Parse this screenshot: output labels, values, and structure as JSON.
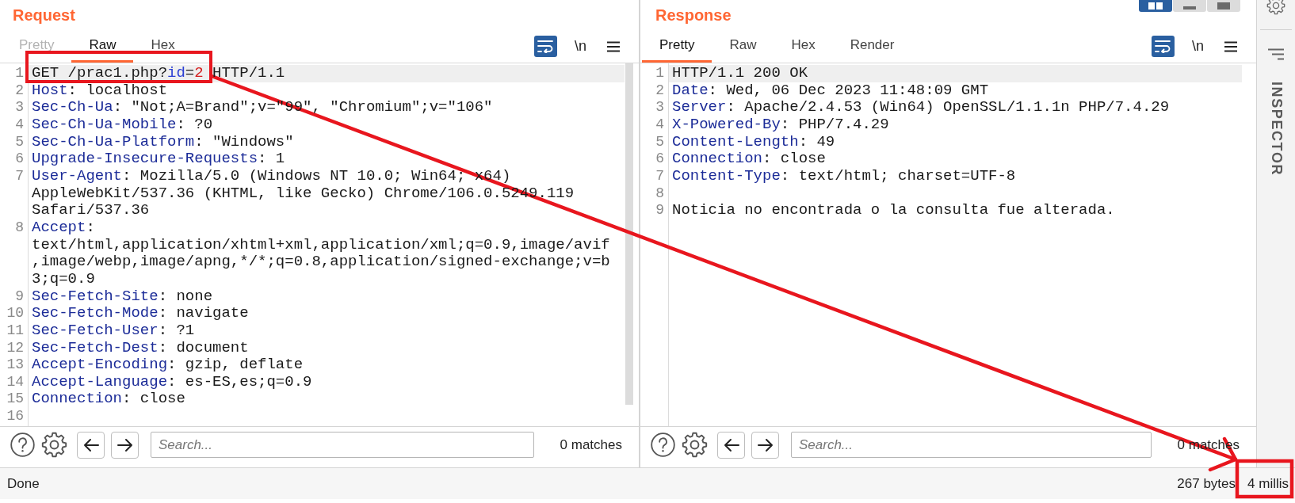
{
  "request": {
    "title": "Request",
    "tabs": [
      {
        "label": "Pretty",
        "selected": false,
        "disabled": true
      },
      {
        "label": "Raw",
        "selected": true,
        "disabled": false
      },
      {
        "label": "Hex",
        "selected": false,
        "disabled": false
      }
    ],
    "controls": {
      "word_wrap": true,
      "newline_label": "\\n"
    },
    "lines": [
      {
        "number": "1",
        "highlighted": true,
        "tokens": [
          {
            "kind": "text",
            "text": "GET /prac1.php?"
          },
          {
            "kind": "param_name",
            "text": "id"
          },
          {
            "kind": "text",
            "text": "="
          },
          {
            "kind": "param_value",
            "text": "2"
          },
          {
            "kind": "text",
            "text": " HTTP/1.1"
          }
        ]
      },
      {
        "number": "2",
        "highlighted": false,
        "tokens": [
          {
            "kind": "header_name",
            "text": "Host"
          },
          {
            "kind": "text",
            "text": ": localhost"
          }
        ]
      },
      {
        "number": "3",
        "highlighted": false,
        "tokens": [
          {
            "kind": "header_name",
            "text": "Sec-Ch-Ua"
          },
          {
            "kind": "text",
            "text": ": \"Not;A=Brand\";v=\"99\", \"Chromium\";v=\"106\""
          }
        ]
      },
      {
        "number": "4",
        "highlighted": false,
        "tokens": [
          {
            "kind": "header_name",
            "text": "Sec-Ch-Ua-Mobile"
          },
          {
            "kind": "text",
            "text": ": ?0"
          }
        ]
      },
      {
        "number": "5",
        "highlighted": false,
        "tokens": [
          {
            "kind": "header_name",
            "text": "Sec-Ch-Ua-Platform"
          },
          {
            "kind": "text",
            "text": ": \"Windows\""
          }
        ]
      },
      {
        "number": "6",
        "highlighted": false,
        "tokens": [
          {
            "kind": "header_name",
            "text": "Upgrade-Insecure-Requests"
          },
          {
            "kind": "text",
            "text": ": 1"
          }
        ]
      },
      {
        "number": "7",
        "highlighted": false,
        "tokens": [
          {
            "kind": "header_name",
            "text": "User-Agent"
          },
          {
            "kind": "text",
            "text": ": Mozilla/5.0 (Windows NT 10.0; Win64; x64)"
          }
        ],
        "continued": [
          "AppleWebKit/537.36 (KHTML, like Gecko) Chrome/106.0.5249.119",
          "Safari/537.36"
        ]
      },
      {
        "number": "8",
        "highlighted": false,
        "tokens": [
          {
            "kind": "header_name",
            "text": "Accept"
          },
          {
            "kind": "text",
            "text": ":"
          }
        ],
        "continued": [
          "text/html,application/xhtml+xml,application/xml;q=0.9,image/avif",
          ",image/webp,image/apng,*/*;q=0.8,application/signed-exchange;v=b",
          "3;q=0.9"
        ]
      },
      {
        "number": "9",
        "highlighted": false,
        "tokens": [
          {
            "kind": "header_name",
            "text": "Sec-Fetch-Site"
          },
          {
            "kind": "text",
            "text": ": none"
          }
        ]
      },
      {
        "number": "10",
        "highlighted": false,
        "tokens": [
          {
            "kind": "header_name",
            "text": "Sec-Fetch-Mode"
          },
          {
            "kind": "text",
            "text": ": navigate"
          }
        ]
      },
      {
        "number": "11",
        "highlighted": false,
        "tokens": [
          {
            "kind": "header_name",
            "text": "Sec-Fetch-User"
          },
          {
            "kind": "text",
            "text": ": ?1"
          }
        ]
      },
      {
        "number": "12",
        "highlighted": false,
        "tokens": [
          {
            "kind": "header_name",
            "text": "Sec-Fetch-Dest"
          },
          {
            "kind": "text",
            "text": ": document"
          }
        ]
      },
      {
        "number": "13",
        "highlighted": false,
        "tokens": [
          {
            "kind": "header_name",
            "text": "Accept-Encoding"
          },
          {
            "kind": "text",
            "text": ": gzip, deflate"
          }
        ]
      },
      {
        "number": "14",
        "highlighted": false,
        "tokens": [
          {
            "kind": "header_name",
            "text": "Accept-Language"
          },
          {
            "kind": "text",
            "text": ": es-ES,es;q=0.9"
          }
        ]
      },
      {
        "number": "15",
        "highlighted": false,
        "tokens": [
          {
            "kind": "header_name",
            "text": "Connection"
          },
          {
            "kind": "text",
            "text": ": close"
          }
        ]
      },
      {
        "number": "16",
        "highlighted": false
      }
    ],
    "search": {
      "placeholder": "Search...",
      "matches": "0 matches"
    }
  },
  "response": {
    "title": "Response",
    "tabs": [
      {
        "label": "Pretty",
        "selected": true,
        "disabled": false
      },
      {
        "label": "Raw",
        "selected": false,
        "disabled": false
      },
      {
        "label": "Hex",
        "selected": false,
        "disabled": false
      },
      {
        "label": "Render",
        "selected": false,
        "disabled": false
      }
    ],
    "controls": {
      "word_wrap": true,
      "newline_label": "\\n"
    },
    "lines": [
      {
        "number": "1",
        "highlighted": true,
        "tokens": [
          {
            "kind": "text",
            "text": "HTTP/1.1 200 OK"
          }
        ]
      },
      {
        "number": "2",
        "highlighted": false,
        "tokens": [
          {
            "kind": "header_name",
            "text": "Date"
          },
          {
            "kind": "text",
            "text": ": Wed, 06 Dec 2023 11:48:09 GMT"
          }
        ]
      },
      {
        "number": "3",
        "highlighted": false,
        "tokens": [
          {
            "kind": "header_name",
            "text": "Server"
          },
          {
            "kind": "text",
            "text": ": Apache/2.4.53 (Win64) OpenSSL/1.1.1n PHP/7.4.29"
          }
        ]
      },
      {
        "number": "4",
        "highlighted": false,
        "tokens": [
          {
            "kind": "header_name",
            "text": "X-Powered-By"
          },
          {
            "kind": "text",
            "text": ": PHP/7.4.29"
          }
        ]
      },
      {
        "number": "5",
        "highlighted": false,
        "tokens": [
          {
            "kind": "header_name",
            "text": "Content-Length"
          },
          {
            "kind": "text",
            "text": ": 49"
          }
        ]
      },
      {
        "number": "6",
        "highlighted": false,
        "tokens": [
          {
            "kind": "header_name",
            "text": "Connection"
          },
          {
            "kind": "text",
            "text": ": close"
          }
        ]
      },
      {
        "number": "7",
        "highlighted": false,
        "tokens": [
          {
            "kind": "header_name",
            "text": "Content-Type"
          },
          {
            "kind": "text",
            "text": ": text/html; charset=UTF-8"
          }
        ]
      },
      {
        "number": "8",
        "highlighted": false
      },
      {
        "number": "9",
        "highlighted": false,
        "tokens": [
          {
            "kind": "text",
            "text": "Noticia no encontrada o la consulta fue alterada."
          }
        ]
      }
    ],
    "search": {
      "placeholder": "Search...",
      "matches": "0 matches"
    }
  },
  "view_modes": [
    {
      "kind": "side_by_side",
      "selected": true
    },
    {
      "kind": "top_bottom",
      "selected": false
    },
    {
      "kind": "tabs",
      "selected": false
    }
  ],
  "sidebar": {
    "label": "INSPECTOR"
  },
  "status_bar": {
    "message": "Done",
    "size": "267 bytes",
    "time": "4 millis"
  }
}
